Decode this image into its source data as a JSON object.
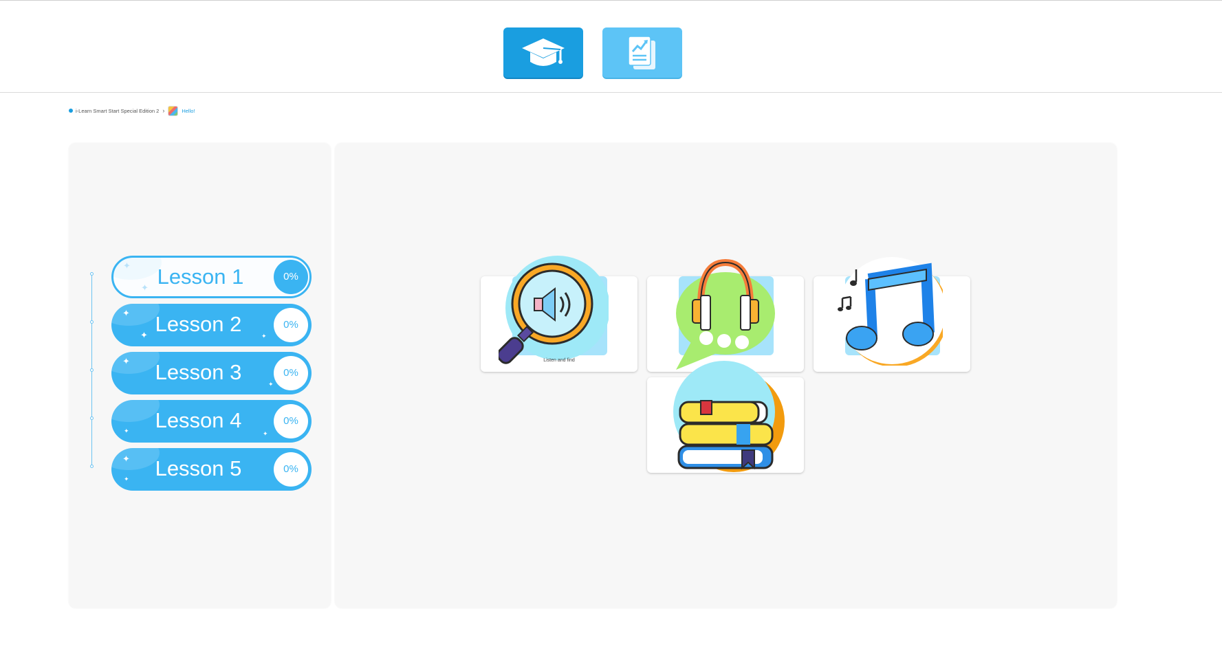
{
  "header": {
    "buttons": [
      {
        "name": "learn",
        "icon": "graduation-cap-icon"
      },
      {
        "name": "report",
        "icon": "report-chart-icon"
      }
    ]
  },
  "breadcrumb": {
    "course": "i-Learn Smart Start Special Edition 2",
    "separator": "›",
    "current": "Hello!"
  },
  "lessons": [
    {
      "label": "Lesson 1",
      "progress": "0%",
      "active": true
    },
    {
      "label": "Lesson 2",
      "progress": "0%",
      "active": false
    },
    {
      "label": "Lesson 3",
      "progress": "0%",
      "active": false
    },
    {
      "label": "Lesson 4",
      "progress": "0%",
      "active": false
    },
    {
      "label": "Lesson 5",
      "progress": "0%",
      "active": false
    }
  ],
  "activities": [
    {
      "caption": "Listen and find",
      "icon": "magnifier-speaker-icon"
    },
    {
      "caption": "",
      "icon": "headphones-chat-icon"
    },
    {
      "caption": "",
      "icon": "music-note-icon"
    },
    {
      "caption": "",
      "icon": "books-stack-icon"
    }
  ],
  "colors": {
    "primary": "#1a9ee0",
    "lesson_blue": "#3ab4f2",
    "report_blue": "#5dc4f6",
    "panel_bg": "#f7f7f7"
  }
}
